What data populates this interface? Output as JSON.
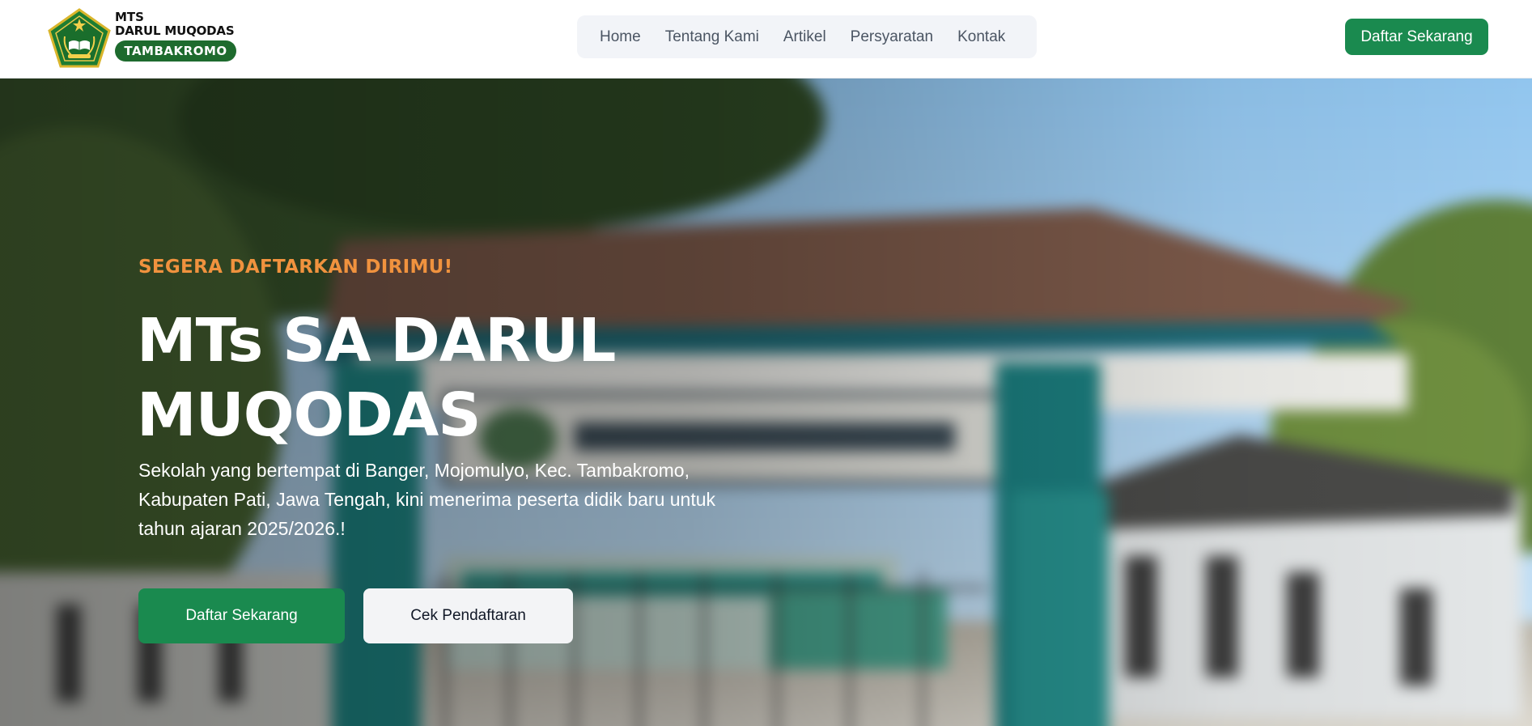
{
  "header": {
    "logo": {
      "line1": "MTS",
      "line2": "DARUL MUQODAS",
      "pill": "TAMBAKROMO"
    },
    "nav": [
      {
        "label": "Home"
      },
      {
        "label": "Tentang Kami"
      },
      {
        "label": "Artikel"
      },
      {
        "label": "Persyaratan"
      },
      {
        "label": "Kontak"
      }
    ],
    "cta_label": "Daftar Sekarang"
  },
  "hero": {
    "eyebrow": "SEGERA DAFTARKAN DIRIMU!",
    "title": "MTs SA DARUL MUQODAS",
    "description": "Sekolah yang bertempat di Banger, Mojomulyo, Kec. Tambakromo, Kabupaten Pati, Jawa Tengah, kini menerima peserta didik baru untuk tahun ajaran 2025/2026.!",
    "primary_button": "Daftar Sekarang",
    "secondary_button": "Cek Pendaftaran"
  },
  "colors": {
    "brand_green": "#1a8a4f",
    "logo_green": "#1e6b2e",
    "accent_orange": "#f0923e",
    "nav_background": "#f2f4f8"
  },
  "icons": {
    "logo_emblem": "kemenag-emblem-icon"
  }
}
